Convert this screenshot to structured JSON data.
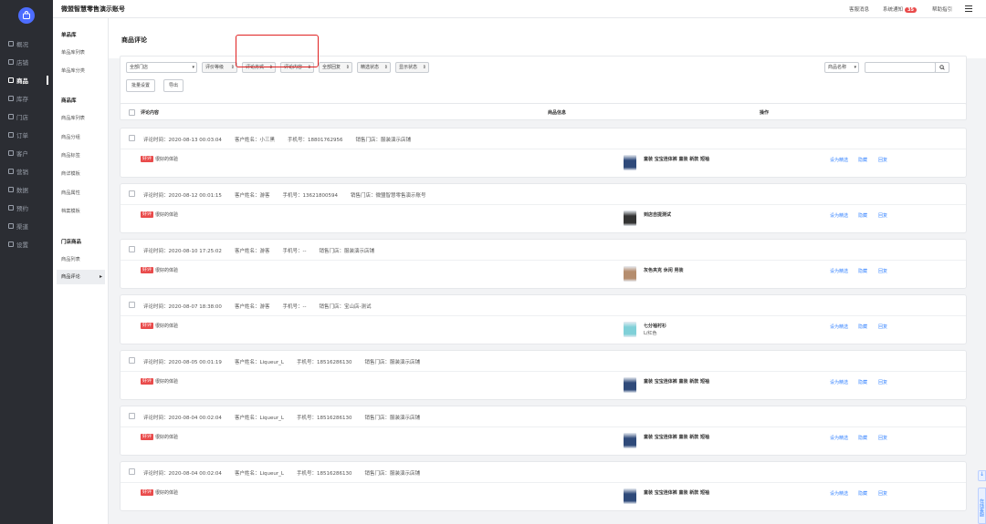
{
  "app": {
    "title": "微盟智慧零售演示账号"
  },
  "header": {
    "links": [
      "客服消息",
      "系统通知",
      "帮助指引"
    ],
    "notice_count": "35"
  },
  "nav": {
    "items": [
      {
        "label": "概况",
        "icon": "dashboard-icon"
      },
      {
        "label": "店铺",
        "icon": "store-icon"
      },
      {
        "label": "商品",
        "icon": "goods-icon"
      },
      {
        "label": "库存",
        "icon": "inventory-icon"
      },
      {
        "label": "门店",
        "icon": "shop-icon"
      },
      {
        "label": "订单",
        "icon": "order-icon"
      },
      {
        "label": "客户",
        "icon": "customer-icon"
      },
      {
        "label": "营销",
        "icon": "marketing-icon"
      },
      {
        "label": "数据",
        "icon": "chart-icon"
      },
      {
        "label": "预约",
        "icon": "calendar-icon"
      },
      {
        "label": "渠道",
        "icon": "channel-icon"
      },
      {
        "label": "设置",
        "icon": "gear-icon"
      }
    ],
    "active_index": 2
  },
  "subnav": {
    "groups": [
      {
        "title": "单品库",
        "items": [
          "单品库列表",
          "单品库分类"
        ]
      },
      {
        "title": "商品库",
        "items": [
          "商品库列表",
          "商品分组",
          "商品标签",
          "商详模板",
          "商品属性",
          "档案模板"
        ]
      },
      {
        "title": "门店商品",
        "items": [
          "商品列表",
          "商品评论"
        ]
      }
    ]
  },
  "page": {
    "title": "商品评论"
  },
  "filters": {
    "store": "全部门店",
    "rating": "评价等级",
    "method": "评论方式",
    "content": "评论内容",
    "reply": "全部回复",
    "featured": "精选状态",
    "display": "显示状态",
    "search_type": "商品名称",
    "search_value": "",
    "batch_button": "批量设置",
    "export_button": "导出"
  },
  "table": {
    "headers": [
      "评论内容",
      "商品信息",
      "操作"
    ]
  },
  "labels": {
    "time": "评论时间：",
    "customer": "客户姓名：",
    "phone": "手机号：",
    "store": "销售门店："
  },
  "actions": [
    "设为精选",
    "隐藏",
    "回复"
  ],
  "reviews": [
    {
      "time": "2020-08-13 00:03:04",
      "customer": "小三黑",
      "phone": "18801762956",
      "store": "服装演示店铺",
      "tag": "好评",
      "comment": "很好的体验",
      "product": "童装 宝宝连体裤 童装 新款 短袖",
      "sku": ""
    },
    {
      "time": "2020-08-12 00:01:15",
      "customer": "游客",
      "phone": "13621800594",
      "store": "微盟智慧零售演示账号",
      "tag": "好评",
      "comment": "很好的体验",
      "product": "到店自提测试",
      "sku": ""
    },
    {
      "time": "2020-08-10 17:25:02",
      "customer": "游客",
      "phone": "--",
      "store": "服装演示店铺",
      "tag": "好评",
      "comment": "很好的体验",
      "product": "灰色夹克 休闲 男装",
      "sku": ""
    },
    {
      "time": "2020-08-07 18:38:00",
      "customer": "游客",
      "phone": "--",
      "store": "宝山店-测试",
      "tag": "好评",
      "comment": "很好的体验",
      "product": "七分袖衬衫",
      "sku": "L/红色"
    },
    {
      "time": "2020-08-05 00:01:19",
      "customer": "Liqueur_L",
      "phone": "18516286130",
      "store": "服装演示店铺",
      "tag": "好评",
      "comment": "很好的体验",
      "product": "童装 宝宝连体裤 童装 新款 短袖",
      "sku": ""
    },
    {
      "time": "2020-08-04 00:02:04",
      "customer": "Liqueur_L",
      "phone": "18516286130",
      "store": "服装演示店铺",
      "tag": "好评",
      "comment": "很好的体验",
      "product": "童装 宝宝连体裤 童装 新款 短袖",
      "sku": ""
    },
    {
      "time": "2020-08-04 00:02:04",
      "customer": "Liqueur_L",
      "phone": "18516286130",
      "store": "服装演示店铺",
      "tag": "好评",
      "comment": "很好的体验",
      "product": "童装 宝宝连体裤 童装 新款 短袖",
      "sku": ""
    }
  ],
  "float": {
    "download": "↓",
    "online": "在线客服"
  },
  "colors": {
    "accent": "#3a86ff",
    "tag": "#e94b4b",
    "highlight": "#e02020",
    "nav_bg": "#2b2d33"
  }
}
